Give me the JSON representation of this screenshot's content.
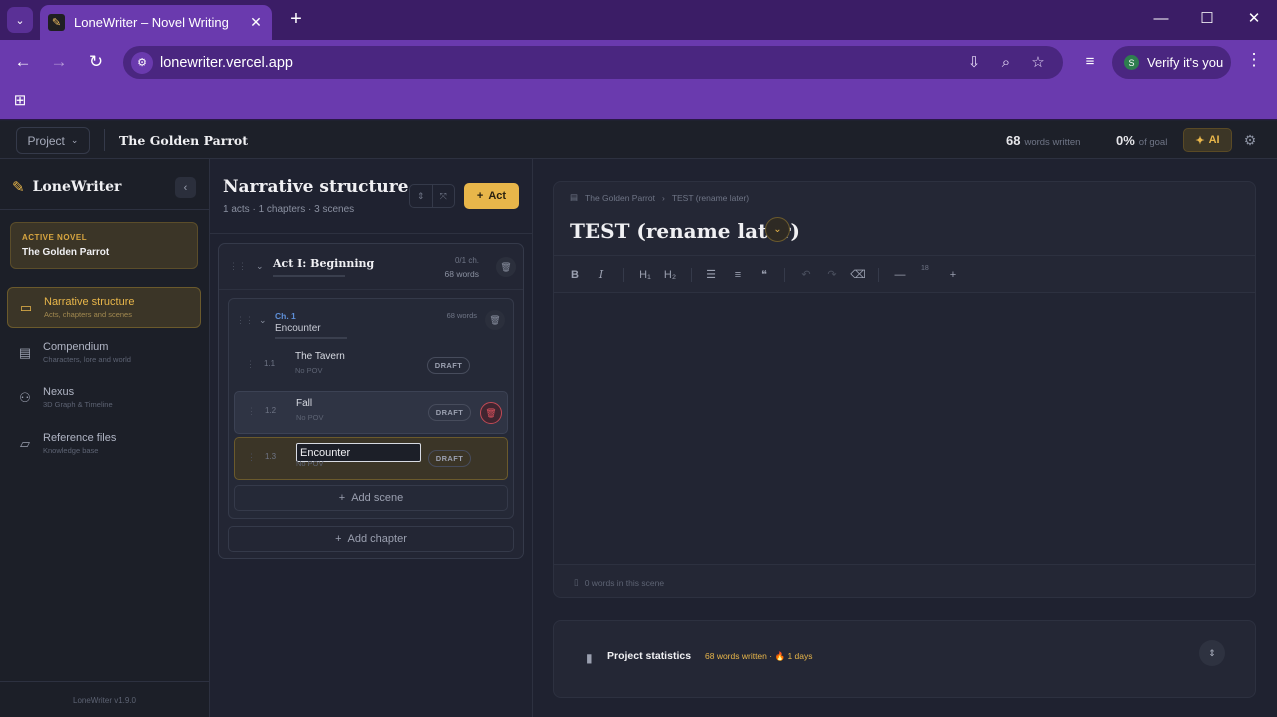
{
  "browser": {
    "tab_title": "LoneWriter – Novel Writing",
    "url": "lonewriter.vercel.app",
    "profile_label": "Verify it's you",
    "profile_initial": "S",
    "accent_color": "#6a3aae"
  },
  "header": {
    "project_menu": "Project",
    "project_title": "The Golden Parrot",
    "words_written_value": "68",
    "words_written_label": "words written",
    "goal_value": "0%",
    "goal_label": "of goal",
    "ai_label": "AI"
  },
  "sidebar": {
    "logo": "LoneWriter",
    "active_novel_caption": "ACTIVE NOVEL",
    "active_novel_name": "The Golden Parrot",
    "items": [
      {
        "title": "Narrative structure",
        "subtitle": "Acts, chapters and scenes",
        "icon": "book-open-icon"
      },
      {
        "title": "Compendium",
        "subtitle": "Characters, lore and world",
        "icon": "book-icon"
      },
      {
        "title": "Nexus",
        "subtitle": "3D Graph & Timeline",
        "icon": "graph-icon"
      },
      {
        "title": "Reference files",
        "subtitle": "Knowledge base",
        "icon": "folder-icon"
      }
    ],
    "version": "LoneWriter v1.9.0"
  },
  "structure": {
    "title": "Narrative structure",
    "summary": "1 acts · 1 chapters · 3 scenes",
    "add_act_label": "Act",
    "act": {
      "title": "Act I: Beginning",
      "chapter_count": "0/1 ch.",
      "words": "68 words"
    },
    "chapter": {
      "number": "Ch. 1",
      "title": "Encounter",
      "words": "68 words"
    },
    "scenes": [
      {
        "number": "1.1",
        "title": "The Tavern",
        "pov": "No POV",
        "status": "DRAFT"
      },
      {
        "number": "1.2",
        "title": "Fall",
        "pov": "No POV",
        "status": "DRAFT"
      },
      {
        "number": "1.3",
        "title": "Encounter",
        "pov": "No POV",
        "status": "DRAFT"
      }
    ],
    "add_scene_label": "Add scene",
    "add_chapter_label": "Add chapter"
  },
  "editor": {
    "breadcrumb_project": "The Golden Parrot",
    "breadcrumb_scene": "TEST (rename later)",
    "scene_title": "TEST (rename later)",
    "toolbar": {
      "bold": "B",
      "italic": "I",
      "h1": "H₁",
      "h2": "H₂",
      "font_size": "18"
    },
    "word_count": "0 words in this scene"
  },
  "stats": {
    "title": "Project statistics",
    "words": "68 words written",
    "separator": "·",
    "days": "1 days"
  }
}
